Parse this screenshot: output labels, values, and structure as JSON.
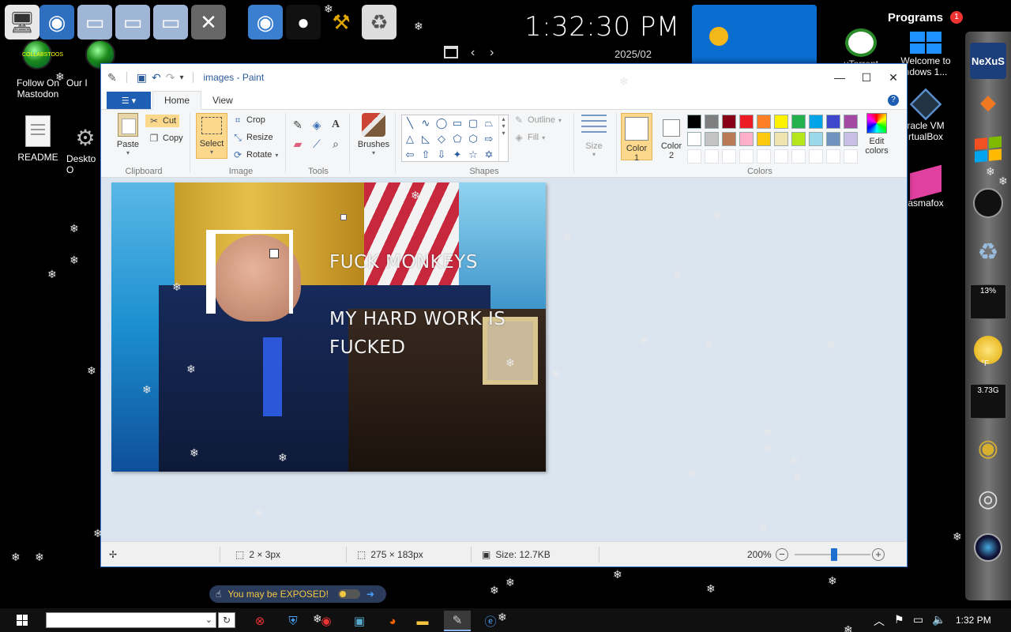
{
  "desktop": {
    "top_icons": [
      {
        "name": "computer-icon",
        "glyph": "🖥",
        "color": "#cfd6e0"
      },
      {
        "name": "globe-icon",
        "glyph": "🌐",
        "color": "#3c7fd1"
      },
      {
        "name": "folder-icon",
        "glyph": "📁",
        "color": "#b9c9e0"
      },
      {
        "name": "folder-icon-2",
        "glyph": "📁",
        "color": "#b9c9e0"
      },
      {
        "name": "network-folder-icon",
        "glyph": "🗂",
        "color": "#b9c9e0"
      },
      {
        "name": "tools-icon",
        "glyph": "🛠",
        "color": "#aaa"
      },
      {
        "name": "ie-globe-icon",
        "glyph": "🌍",
        "color": "#3c7fd1"
      },
      {
        "name": "person-icon",
        "glyph": "👤",
        "color": "#222"
      },
      {
        "name": "hammer-icon",
        "glyph": "⚒",
        "color": "#e0a800"
      },
      {
        "name": "recycle-bin-icon",
        "glyph": "🗑",
        "color": "#ccc"
      }
    ],
    "left_icons": [
      {
        "label": "Follow On\nMastodon"
      },
      {
        "label": "Our I"
      },
      {
        "label": "README"
      },
      {
        "label": "Deskto\nO"
      }
    ],
    "collab_text": "COLLABSTOOS",
    "right_icons": [
      {
        "label": "uTorrent"
      },
      {
        "label": "Welcome to\nndows 1..."
      },
      {
        "label": "racle VM\nrtualBox"
      },
      {
        "label": "asmafox"
      }
    ],
    "programs_label": "Programs",
    "programs_badge": "1"
  },
  "clock_widget": {
    "time": "1:32:30 PM",
    "date": "2025/02",
    "prev_icon": "‹",
    "next_icon": "›"
  },
  "dock": {
    "nexus_label": "NeXuS",
    "cpu_meter": "13%",
    "weather_temp": "°F",
    "ram_meter": "3.73G"
  },
  "paint": {
    "title": "images - Paint",
    "tabs": [
      "Home",
      "View"
    ],
    "clipboard": {
      "paste": "Paste",
      "cut": "Cut",
      "copy": "Copy",
      "label": "Clipboard"
    },
    "image": {
      "select": "Select",
      "crop": "Crop",
      "resize": "Resize",
      "rotate": "Rotate",
      "label": "Image"
    },
    "tools": {
      "label": "Tools"
    },
    "brushes": {
      "label": "Brushes"
    },
    "shapes": {
      "outline": "Outline",
      "fill": "Fill",
      "label": "Shapes"
    },
    "size": {
      "label": "Size"
    },
    "colors": {
      "color1": "Color 1",
      "color2": "Color 2",
      "edit": "Edit colors",
      "label": "Colors",
      "palette_row1": [
        "#000000",
        "#7f7f7f",
        "#880015",
        "#ed1c24",
        "#ff7f27",
        "#fff200",
        "#22b14c",
        "#00a2e8",
        "#3f48cc",
        "#a349a4"
      ],
      "palette_row2": [
        "#ffffff",
        "#c3c3c3",
        "#b97a57",
        "#ffaec9",
        "#ffc90e",
        "#efe4b0",
        "#b5e61d",
        "#99d9ea",
        "#7092be",
        "#c8bfe7"
      ]
    },
    "image_text": {
      "line1": "FUCK MONKEYS",
      "line2": "MY HARD WORK IS",
      "line3": "FUCKED"
    },
    "status": {
      "selection": "2 × 3px",
      "dimensions": "275 × 183px",
      "size": "Size: 12.7KB",
      "zoom": "200%"
    }
  },
  "notification": {
    "text": "You may be EXPOSED!"
  },
  "taskbar": {
    "time": "1:32 PM"
  }
}
